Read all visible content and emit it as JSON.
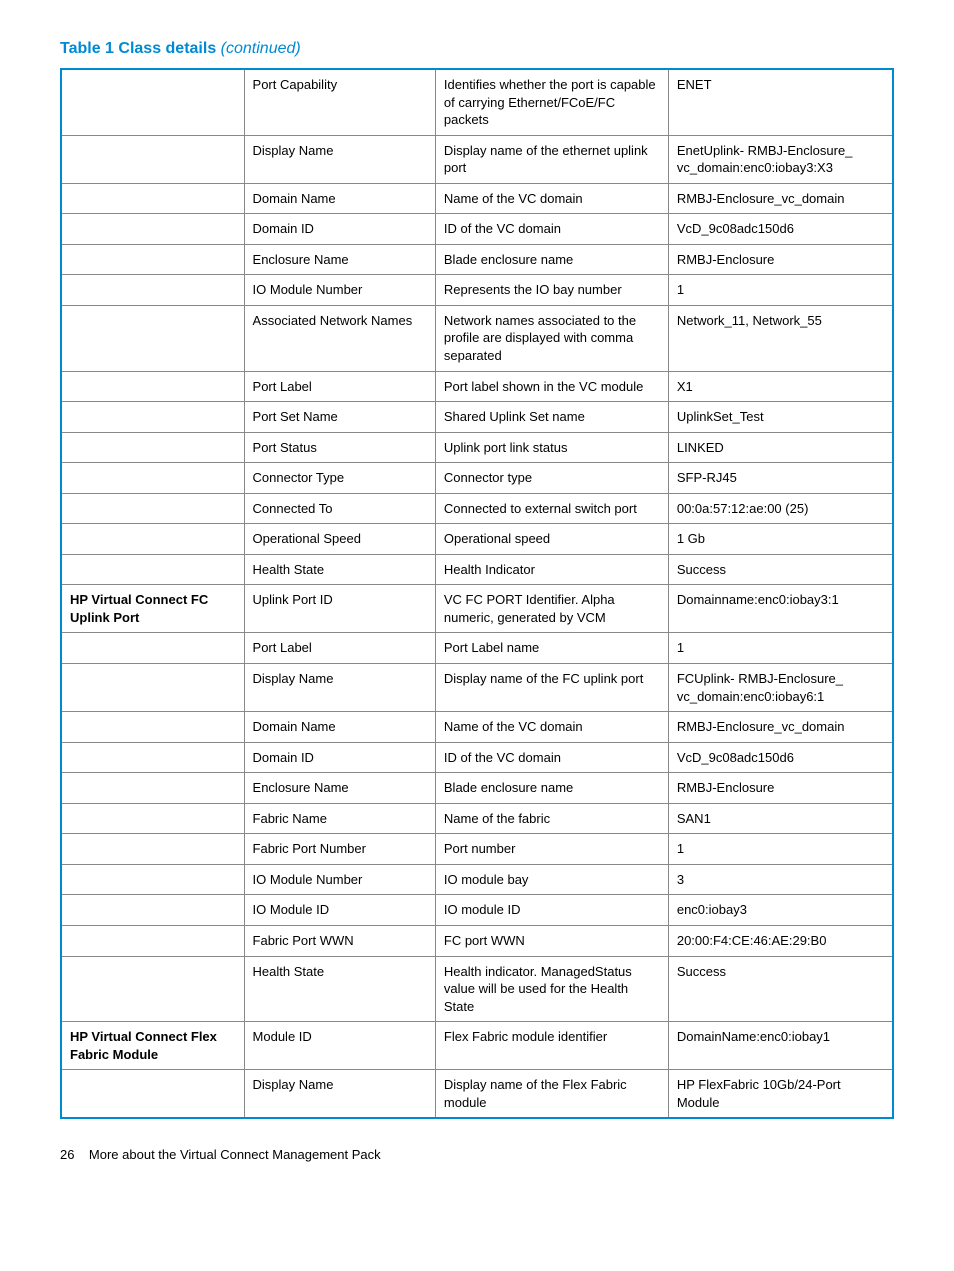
{
  "title_prefix": "Table 1 Class details",
  "title_suffix": "(continued)",
  "footer_page": "26",
  "footer_text": "More about the Virtual Connect Management Pack",
  "rows": [
    {
      "c1": "",
      "c2": "Port Capability",
      "c3": "Identifies whether the port is capable of carrying Ethernet/FCoE/FC packets",
      "c4": "ENET"
    },
    {
      "c1": "",
      "c2": "Display Name",
      "c3": "Display name of the ethernet uplink port",
      "c4": "EnetUplink- RMBJ-Enclosure_ vc_domain:enc0:iobay3:X3"
    },
    {
      "c1": "",
      "c2": "Domain Name",
      "c3": "Name of the VC domain",
      "c4": "RMBJ-Enclosure_vc_domain"
    },
    {
      "c1": "",
      "c2": "Domain ID",
      "c3": "ID of the VC domain",
      "c4": "VcD_9c08adc150d6"
    },
    {
      "c1": "",
      "c2": "Enclosure Name",
      "c3": "Blade enclosure name",
      "c4": "RMBJ-Enclosure"
    },
    {
      "c1": "",
      "c2": "IO Module Number",
      "c3": "Represents the IO bay number",
      "c4": "1"
    },
    {
      "c1": "",
      "c2": "Associated Network Names",
      "c3": "Network names associated to the profile are displayed with comma separated",
      "c4": "Network_11, Network_55"
    },
    {
      "c1": "",
      "c2": "Port Label",
      "c3": "Port label shown in the VC module",
      "c4": "X1"
    },
    {
      "c1": "",
      "c2": "Port Set Name",
      "c3": "Shared Uplink Set name",
      "c4": "UplinkSet_Test"
    },
    {
      "c1": "",
      "c2": "Port Status",
      "c3": "Uplink port link status",
      "c4": "LINKED"
    },
    {
      "c1": "",
      "c2": "Connector Type",
      "c3": "Connector type",
      "c4": "SFP-RJ45"
    },
    {
      "c1": "",
      "c2": "Connected To",
      "c3": "Connected to external switch port",
      "c4": "00:0a:57:12:ae:00 (25)"
    },
    {
      "c1": "",
      "c2": "Operational Speed",
      "c3": "Operational speed",
      "c4": "1 Gb"
    },
    {
      "c1": "",
      "c2": "Health State",
      "c3": "Health Indicator",
      "c4": "Success"
    },
    {
      "c1": "HP Virtual Connect FC Uplink Port",
      "c2": "Uplink Port ID",
      "c3": "VC FC PORT Identifier. Alpha numeric, generated by VCM",
      "c4": "Domainname:enc0:iobay3:1"
    },
    {
      "c1": "",
      "c2": "Port Label",
      "c3": "Port Label name",
      "c4": "1"
    },
    {
      "c1": "",
      "c2": "Display Name",
      "c3": "Display name of the FC uplink port",
      "c4": "FCUplink- RMBJ-Enclosure_ vc_domain:enc0:iobay6:1"
    },
    {
      "c1": "",
      "c2": "Domain Name",
      "c3": "Name of the VC domain",
      "c4": "RMBJ-Enclosure_vc_domain"
    },
    {
      "c1": "",
      "c2": "Domain ID",
      "c3": "ID of the VC domain",
      "c4": "VcD_9c08adc150d6"
    },
    {
      "c1": "",
      "c2": "Enclosure Name",
      "c3": "Blade enclosure name",
      "c4": "RMBJ-Enclosure"
    },
    {
      "c1": "",
      "c2": "Fabric Name",
      "c3": "Name of the fabric",
      "c4": "SAN1"
    },
    {
      "c1": "",
      "c2": "Fabric Port Number",
      "c3": "Port number",
      "c4": "1"
    },
    {
      "c1": "",
      "c2": "IO Module Number",
      "c3": "IO module bay",
      "c4": "3"
    },
    {
      "c1": "",
      "c2": "IO Module ID",
      "c3": "IO module ID",
      "c4": "enc0:iobay3"
    },
    {
      "c1": "",
      "c2": "Fabric Port WWN",
      "c3": "FC port WWN",
      "c4": "20:00:F4:CE:46:AE:29:B0"
    },
    {
      "c1": "",
      "c2": "Health State",
      "c3": "Health indicator. ManagedStatus value will be used for the Health State",
      "c4": "Success"
    },
    {
      "c1": "HP Virtual Connect Flex Fabric Module",
      "c2": "Module ID",
      "c3": "Flex Fabric module identifier",
      "c4": "DomainName:enc0:iobay1"
    },
    {
      "c1": "",
      "c2": "Display Name",
      "c3": "Display name of the Flex Fabric module",
      "c4": "HP FlexFabric 10Gb/24-Port Module"
    }
  ]
}
